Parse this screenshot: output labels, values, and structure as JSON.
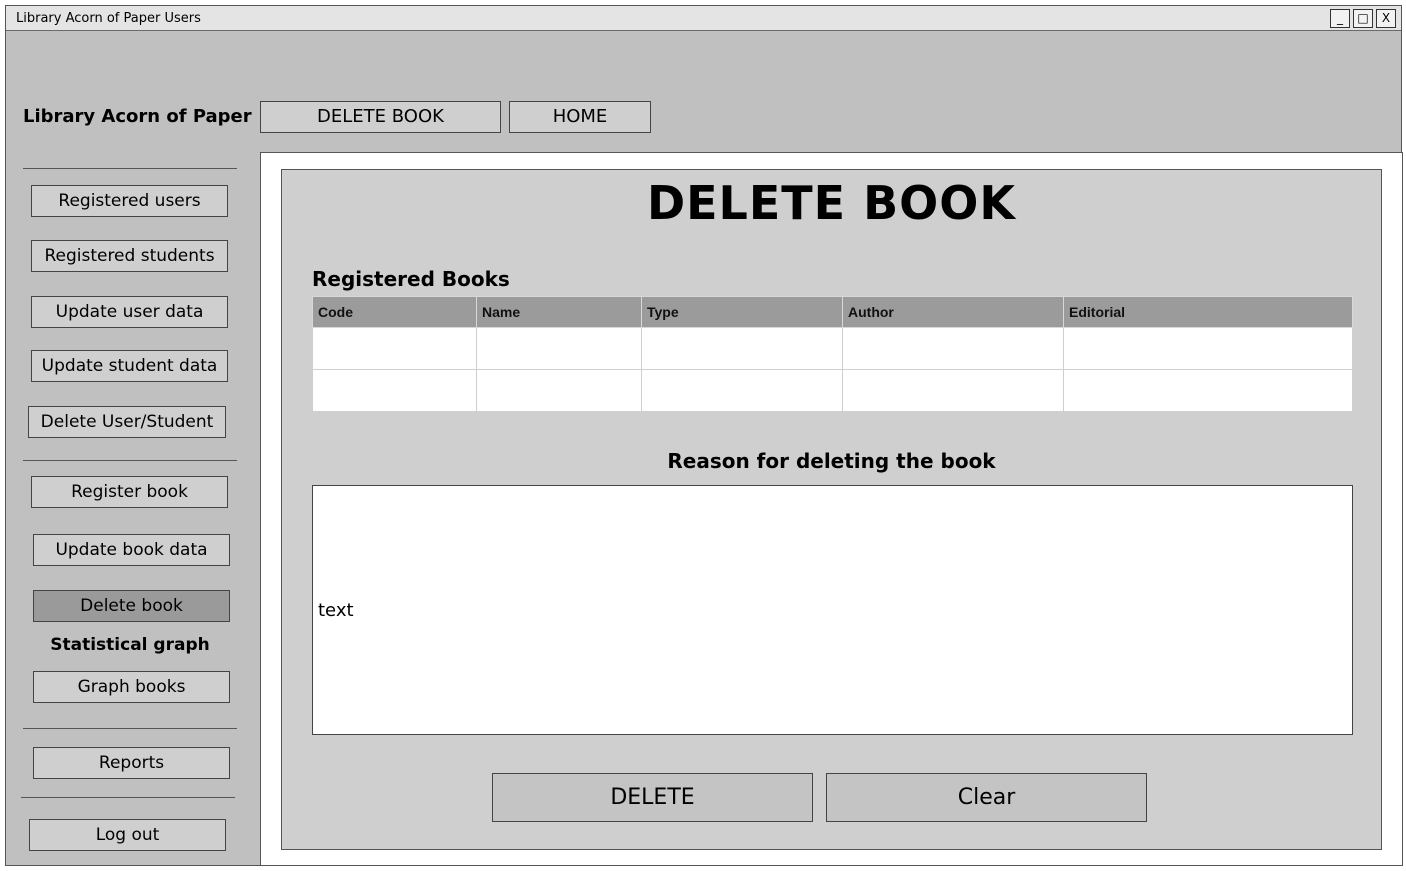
{
  "window": {
    "title": "Library Acorn of Paper Users",
    "controls": [
      "_",
      "□",
      "X"
    ]
  },
  "header": {
    "brand": "Library Acorn of Paper",
    "nav": {
      "delete_book": "DELETE BOOK",
      "home": "HOME"
    }
  },
  "sidebar": {
    "items": [
      {
        "label": "Registered users"
      },
      {
        "label": "Registered students"
      },
      {
        "label": "Update user data"
      },
      {
        "label": "Update student data"
      },
      {
        "label": "Delete User/Student"
      },
      {
        "label": "Register book"
      },
      {
        "label": "Update book data"
      },
      {
        "label": "Delete book",
        "active": true
      },
      {
        "label": "Graph books"
      },
      {
        "label": "Reports"
      },
      {
        "label": "Log out"
      }
    ],
    "section_statistical": "Statistical graph"
  },
  "main": {
    "title": "DELETE BOOK",
    "table_title": "Registered Books",
    "table": {
      "columns": [
        "Code",
        "Name",
        "Type",
        "Author",
        "Editorial"
      ],
      "rows": [
        [
          "",
          "",
          "",
          "",
          ""
        ],
        [
          "",
          "",
          "",
          "",
          ""
        ]
      ]
    },
    "reason_label": "Reason for deleting the book",
    "reason_value": "text",
    "delete_label": "DELETE",
    "clear_label": "Clear"
  },
  "colors": {
    "window_bg": "#c0c0c0",
    "panel_bg": "#cfcfcf",
    "active_item": "#9a9a9a",
    "table_header": "#9b9b9b"
  }
}
